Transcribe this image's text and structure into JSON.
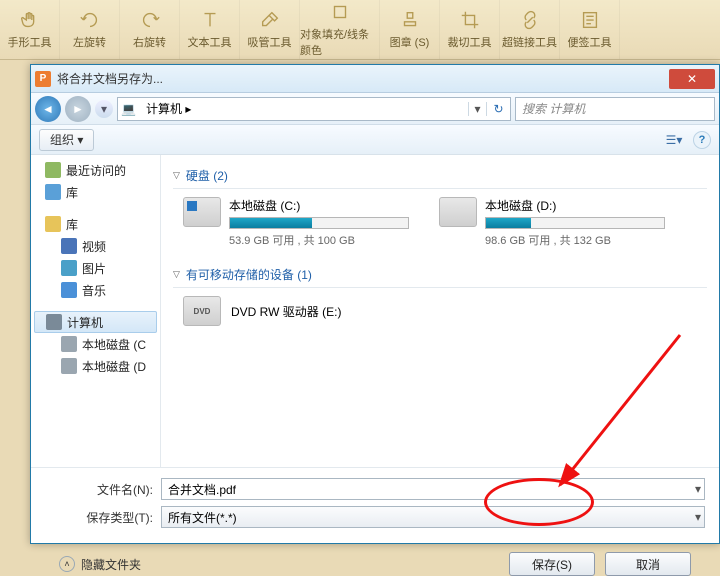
{
  "ribbon": [
    {
      "icon": "hand",
      "label": "手形工具"
    },
    {
      "icon": "rotl",
      "label": "左旋转"
    },
    {
      "icon": "rotr",
      "label": "右旋转"
    },
    {
      "icon": "text",
      "label": "文本工具"
    },
    {
      "icon": "pipette",
      "label": "吸管工具"
    },
    {
      "icon": "fill",
      "label": "对象填充/线条颜色"
    },
    {
      "icon": "stamp",
      "label": "图章 (S)"
    },
    {
      "icon": "crop",
      "label": "裁切工具"
    },
    {
      "icon": "link",
      "label": "超链接工具"
    },
    {
      "icon": "note",
      "label": "便签工具"
    }
  ],
  "dialog": {
    "title": "将合并文档另存为...",
    "breadcrumb": {
      "root": "计算机",
      "arrow": "▸"
    },
    "search_placeholder": "搜索 计算机",
    "organize": "组织 ▾",
    "tree": [
      {
        "icon": "recent",
        "label": "最近访问的",
        "sub": false
      },
      {
        "icon": "lib",
        "label": "库",
        "sub": false
      },
      {
        "icon": "spacer",
        "label": "",
        "sub": false
      },
      {
        "icon": "libo",
        "label": "库",
        "sub": false
      },
      {
        "icon": "video",
        "label": "视频",
        "sub": true
      },
      {
        "icon": "pic",
        "label": "图片",
        "sub": true
      },
      {
        "icon": "music",
        "label": "音乐",
        "sub": true
      },
      {
        "icon": "spacer",
        "label": "",
        "sub": false
      },
      {
        "icon": "pc",
        "label": "计算机",
        "sub": false,
        "sel": true
      },
      {
        "icon": "disk",
        "label": "本地磁盘 (C",
        "sub": true
      },
      {
        "icon": "disk",
        "label": "本地磁盘 (D",
        "sub": true
      }
    ],
    "groups": {
      "hdd": {
        "title": "硬盘 (2)"
      },
      "removable": {
        "title": "有可移动存储的设备 (1)"
      }
    },
    "drives": [
      {
        "name": "本地磁盘 (C:)",
        "free": "53.9 GB 可用 , 共 100 GB",
        "pct": 46
      },
      {
        "name": "本地磁盘 (D:)",
        "free": "98.6 GB 可用 , 共 132 GB",
        "pct": 25
      }
    ],
    "dvd": "DVD RW 驱动器 (E:)",
    "filename_label": "文件名(N):",
    "filename_value": "合并文档.pdf",
    "filetype_label": "保存类型(T):",
    "filetype_value": "所有文件(*.*)",
    "hide_folders": "隐藏文件夹",
    "save": "保存(S)",
    "cancel": "取消"
  }
}
